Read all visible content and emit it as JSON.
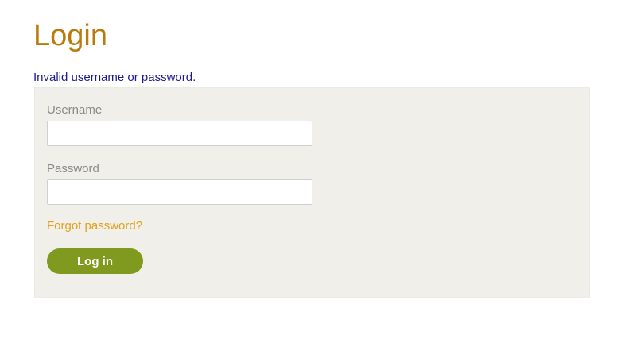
{
  "page": {
    "title": "Login",
    "error_message": "Invalid username or password."
  },
  "form": {
    "username_label": "Username",
    "username_value": "",
    "password_label": "Password",
    "password_value": "",
    "forgot_link": "Forgot password?",
    "submit_label": "Log in"
  },
  "colors": {
    "title": "#b87b0e",
    "error": "#1a1a8c",
    "panel_bg": "#f0efea",
    "label": "#8a8a8a",
    "link": "#e0a21a",
    "button_bg": "#7f9a1f",
    "button_text": "#ffffff"
  }
}
